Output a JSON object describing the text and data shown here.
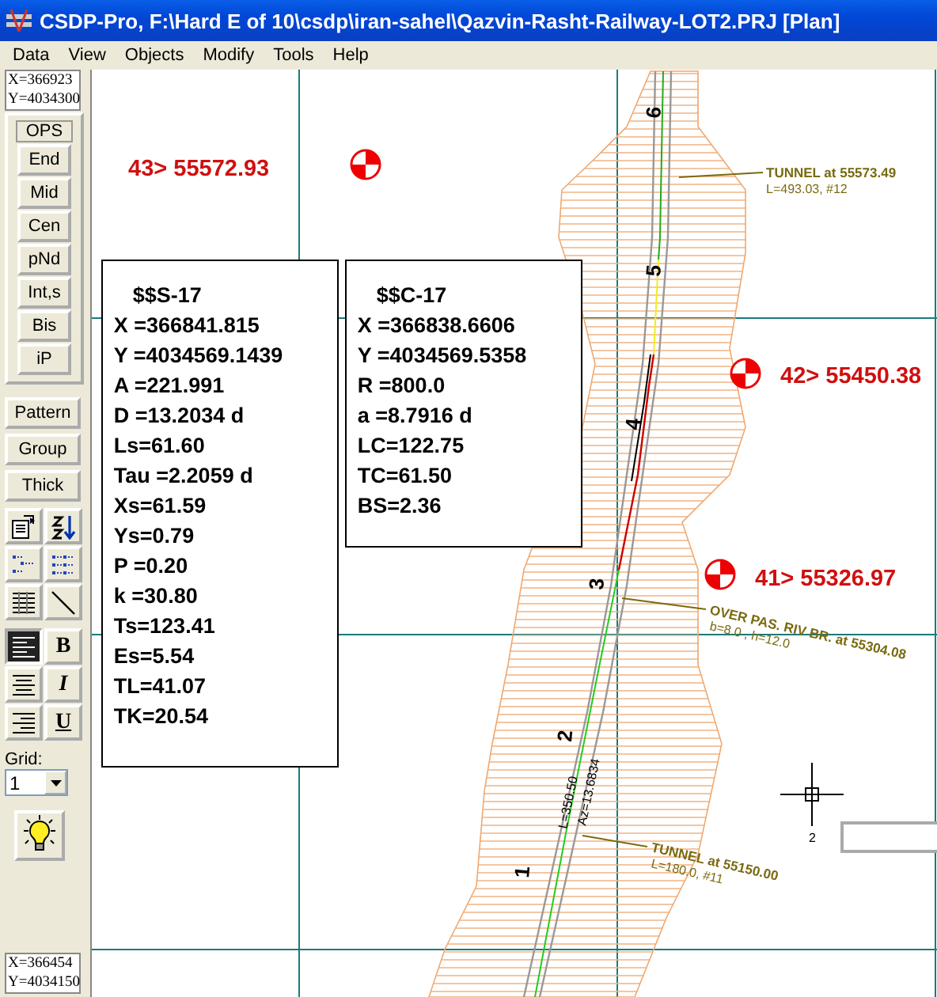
{
  "window": {
    "title": "CSDP-Pro, F:\\Hard E of 10\\csdp\\iran-sahel\\Qazvin-Rasht-Railway-LOT2.PRJ [Plan]"
  },
  "menu": [
    "Data",
    "View",
    "Objects",
    "Modify",
    "Tools",
    "Help"
  ],
  "toolbar": {
    "coord_top": [
      "X=366923",
      "Y=4034300"
    ],
    "snap_title": "OPS",
    "snaps": [
      "End",
      "Mid",
      "Cen",
      "pNd",
      "Int,s",
      "Bis",
      "iP"
    ],
    "buttons": [
      "Pattern",
      "Group",
      "Thick"
    ],
    "tools": [
      {
        "kind": "properties",
        "pressed": false
      },
      {
        "kind": "sort",
        "pressed": false
      },
      {
        "kind": "small-icons",
        "pressed": false
      },
      {
        "kind": "list",
        "pressed": false
      },
      {
        "kind": "details",
        "pressed": false
      },
      {
        "kind": "line",
        "pressed": false
      },
      {
        "kind": "align-left",
        "pressed": true
      },
      {
        "kind": "bold",
        "label": "B",
        "pressed": false
      },
      {
        "kind": "align-center",
        "pressed": false
      },
      {
        "kind": "italic",
        "label": "I",
        "pressed": false
      },
      {
        "kind": "align-right",
        "pressed": false
      },
      {
        "kind": "underline",
        "label": "U",
        "pressed": false
      }
    ],
    "grid_label": "Grid:",
    "grid_value": "1",
    "coord_bottom": [
      "X=366454",
      "Y=4034150"
    ]
  },
  "canvas": {
    "stations": [
      {
        "label": "43> 55572.93"
      },
      {
        "label": "42> 55450.38"
      },
      {
        "label": "41> 55326.97"
      }
    ],
    "info_boxes": [
      {
        "title": "$$S-17",
        "lines": [
          "X =366841.815",
          "Y =4034569.1439",
          "A =221.991",
          "D =13.2034 d",
          "Ls=61.60",
          "Tau =2.2059 d",
          "Xs=61.59",
          "Ys=0.79",
          "P =0.20",
          "k =30.80",
          "Ts=123.41",
          "Es=5.54",
          "TL=41.07",
          "TK=20.54"
        ]
      },
      {
        "title": "$$C-17",
        "lines": [
          "X =366838.6606",
          "Y =4034569.5358",
          "R =800.0",
          "a =8.7916 d",
          "LC=122.75",
          "TC=61.50",
          "BS=2.36"
        ]
      }
    ],
    "chainages": [
      "6",
      "5",
      "4",
      "3",
      "2",
      "1"
    ],
    "annotations": [
      {
        "label": "TUNNEL at  55573.49",
        "note": "L=493.03, #12"
      },
      {
        "label": "OVER PAS. RIV BR. at  55304.08",
        "note": "b=8.0 , h=12.0"
      },
      {
        "label": "TUNNEL at  55150.00",
        "note": "L=180.0, #11"
      }
    ],
    "alignment_labels": [
      "L=350.50",
      "Az=13.6834"
    ],
    "cursor_label": "2"
  }
}
